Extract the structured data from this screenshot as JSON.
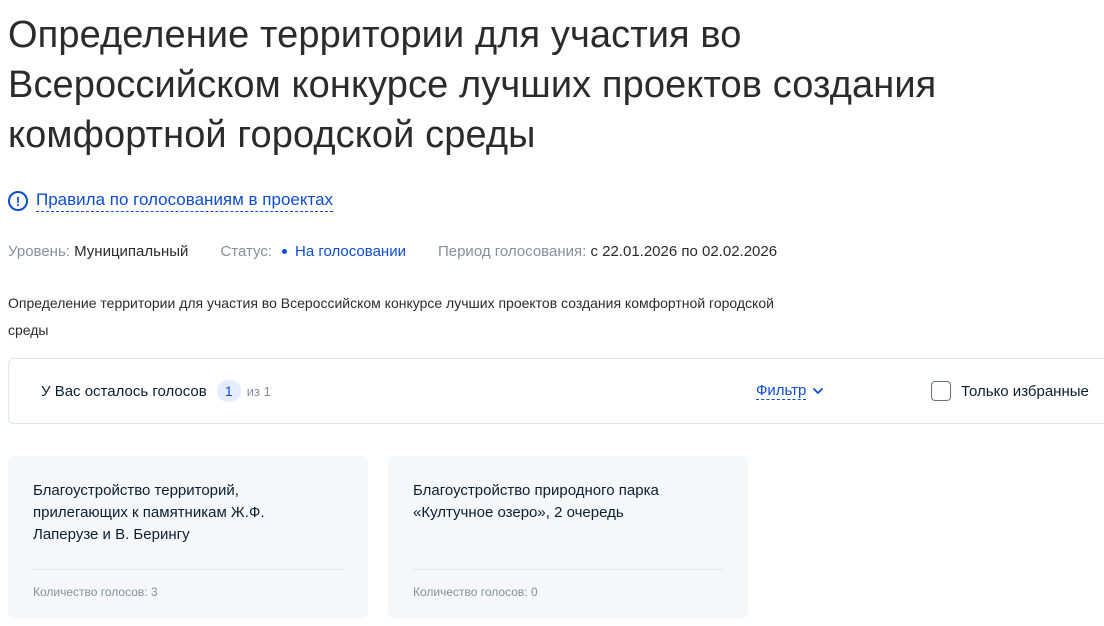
{
  "page": {
    "title": "Определение территории для участия во Всероссийском конкурсе лучших проектов создания комфортной городской среды"
  },
  "rules": {
    "link_label": "Правила по голосованиям в проектах",
    "icon": "exclamation-circle-icon"
  },
  "meta": {
    "level_key": "Уровень:",
    "level_value": "Муниципальный",
    "status_key": "Статус:",
    "status_value": "На голосовании",
    "period_key": "Период голосования:",
    "period_value": "с 22.01.2026 по 02.02.2026"
  },
  "description": "Определение территории для участия во Всероссийском конкурсе лучших проектов создания комфортной городской среды",
  "votes_bar": {
    "remaining_label": "У Вас осталось голосов",
    "remaining_count": "1",
    "of_total": "из 1",
    "filter_label": "Фильтр",
    "favorites_label": "Только избранные",
    "favorites_checked": false
  },
  "projects": [
    {
      "title": "Благоустройство территорий, прилегающих к памятникам Ж.Ф. Лаперузе и В. Берингу",
      "votes": "Количество голосов: 3"
    },
    {
      "title": "Благоустройство природного парка «Култучное озеро», 2 очередь",
      "votes": "Количество голосов: 0"
    }
  ],
  "colors": {
    "accent": "#0d4cd3",
    "muted": "#86909c",
    "card_bg": "#f5f7fa",
    "text": "#0b1f33"
  }
}
